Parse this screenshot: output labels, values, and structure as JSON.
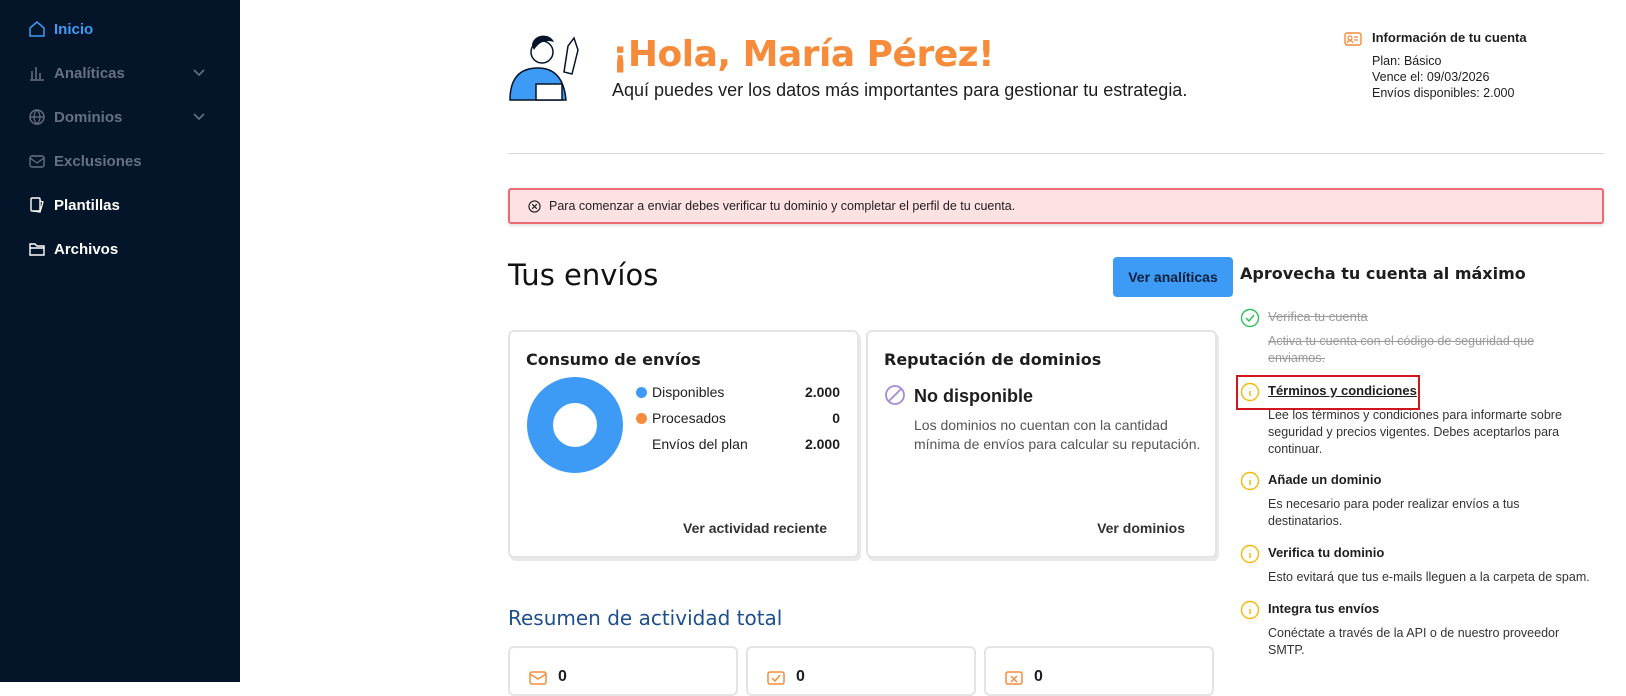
{
  "sidebar": {
    "items": [
      {
        "label": "Inicio",
        "icon": "home-icon",
        "state": "active"
      },
      {
        "label": "Analíticas",
        "icon": "bar-chart-icon",
        "state": "disabled",
        "expandable": true
      },
      {
        "label": "Dominios",
        "icon": "globe-icon",
        "state": "disabled",
        "expandable": true
      },
      {
        "label": "Exclusiones",
        "icon": "mail-block-icon",
        "state": "disabled"
      },
      {
        "label": "Plantillas",
        "icon": "templates-icon",
        "state": "normal"
      },
      {
        "label": "Archivos",
        "icon": "folder-icon",
        "state": "normal"
      }
    ]
  },
  "header": {
    "greeting": "¡Hola, María Pérez!",
    "subtitle": "Aquí puedes ver los datos más importantes para gestionar tu estrategia."
  },
  "account": {
    "title": "Información de tu cuenta",
    "plan": "Plan: Básico",
    "expires": "Vence el: 09/03/2026",
    "sends": "Envíos disponibles: 2.000"
  },
  "alert": {
    "text": "Para comenzar a enviar debes verificar tu dominio y completar el perfil de tu cuenta."
  },
  "sends": {
    "title": "Tus envíos",
    "analytics_button": "Ver analíticas"
  },
  "consumption": {
    "title": "Consumo de envíos",
    "rows": [
      {
        "label": "Disponibles",
        "value": "2.000",
        "color": "#3e9bf5"
      },
      {
        "label": "Procesados",
        "value": "0",
        "color": "#f58b3b"
      },
      {
        "label": "Envíos del plan",
        "value": "2.000"
      }
    ],
    "link": "Ver actividad reciente"
  },
  "reputation": {
    "title": "Reputación de dominios",
    "status": "No disponible",
    "text": "Los dominios no cuentan con la cantidad mínima de envíos para calcular su reputación.",
    "link": "Ver dominios"
  },
  "summary": {
    "title": "Resumen de actividad total",
    "cards": [
      {
        "icon": "mail-sent-icon",
        "value": "0"
      },
      {
        "icon": "mail-check-icon",
        "value": "0"
      },
      {
        "icon": "mail-error-icon",
        "value": "0"
      }
    ]
  },
  "tips": {
    "title": "Aprovecha tu cuenta al máximo",
    "steps": [
      {
        "title": "Verifica tu cuenta",
        "desc": "Activa tu cuenta con el código de seguridad que enviamos.",
        "status": "done"
      },
      {
        "title": "Términos y condiciones",
        "desc": "Lee los términos y condiciones para informarte sobre seguridad y precios vigentes. Debes aceptarlos para continuar.",
        "status": "pending"
      },
      {
        "title": "Añade un dominio",
        "desc": "Es necesario para poder realizar envíos a tus destinatarios.",
        "status": "pending"
      },
      {
        "title": "Verifica tu dominio",
        "desc": "Esto evitará que tus e-mails lleguen a la carpeta de spam.",
        "status": "pending"
      },
      {
        "title": "Integra tus envíos",
        "desc": "Conéctate a través de la API o de nuestro proveedor SMTP.",
        "status": "pending"
      }
    ]
  },
  "colors": {
    "sidebar_bg": "#041429",
    "accent": "#3e9bf5",
    "brand_orange": "#f58b3b",
    "alert_border": "#f06a74",
    "pending_icon": "#f5b90a",
    "done_icon": "#2ec25e"
  }
}
